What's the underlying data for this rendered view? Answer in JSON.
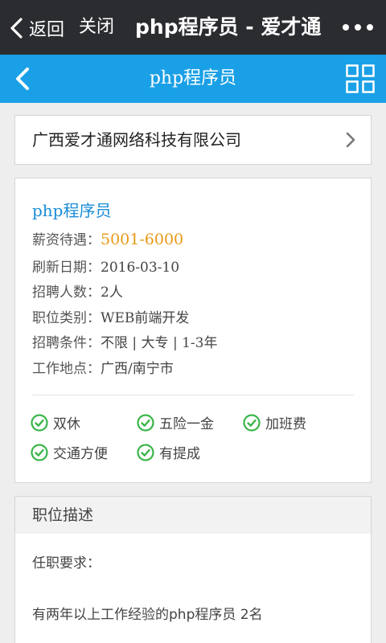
{
  "wechat_bar": {
    "back_label": "返回",
    "close_label": "关闭",
    "title": "php程序员 - 爱才通"
  },
  "page_header": {
    "title": "php程序员"
  },
  "company": {
    "name": "广西爱才通网络科技有限公司"
  },
  "job": {
    "title": "php程序员",
    "details": [
      {
        "label": "薪资待遇：",
        "value": "5001-6000"
      },
      {
        "label": "刷新日期：",
        "value": "2016-03-10"
      },
      {
        "label": "招聘人数：",
        "value": "2人"
      },
      {
        "label": "职位类别：",
        "value": "WEB前端开发"
      },
      {
        "label": "招聘条件：",
        "value": "不限 | 大专 | 1-3年"
      },
      {
        "label": "工作地点：",
        "value": "广西/南宁市"
      }
    ],
    "benefits": [
      "双休",
      "五险一金",
      "加班费",
      "交通方便",
      "有提成"
    ]
  },
  "description": {
    "heading": "职位描述",
    "lines": [
      "任职要求：",
      "有两年以上工作经验的php程序员 2名"
    ]
  },
  "colors": {
    "wechat_bar": "#2b2c30",
    "header_blue": "#1aa0e6",
    "title_blue": "#1a8cd8",
    "salary_orange": "#e79a16",
    "check_green": "#3ab54a"
  }
}
